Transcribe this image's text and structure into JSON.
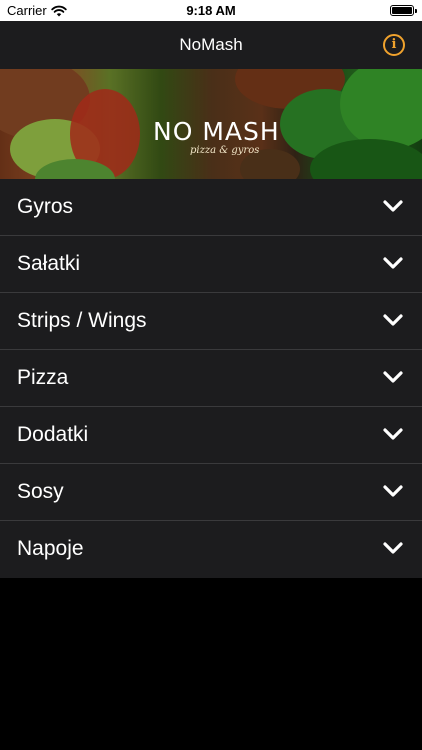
{
  "status_bar": {
    "carrier": "Carrier",
    "time": "9:18 AM",
    "wifi_icon": "wifi-icon",
    "battery_icon": "battery-icon"
  },
  "nav": {
    "title": "NoMash",
    "info_icon": "info-icon",
    "info_glyph": "i",
    "accent_color": "#f0a22d"
  },
  "banner": {
    "logo": "NO MASH",
    "tagline": "pizza & gyros"
  },
  "menu": {
    "items": [
      {
        "label": "Gyros"
      },
      {
        "label": "Sałatki"
      },
      {
        "label": "Strips / Wings"
      },
      {
        "label": "Pizza"
      },
      {
        "label": "Dodatki"
      },
      {
        "label": "Sosy"
      },
      {
        "label": "Napoje"
      }
    ],
    "expand_icon": "chevron-down-icon"
  }
}
